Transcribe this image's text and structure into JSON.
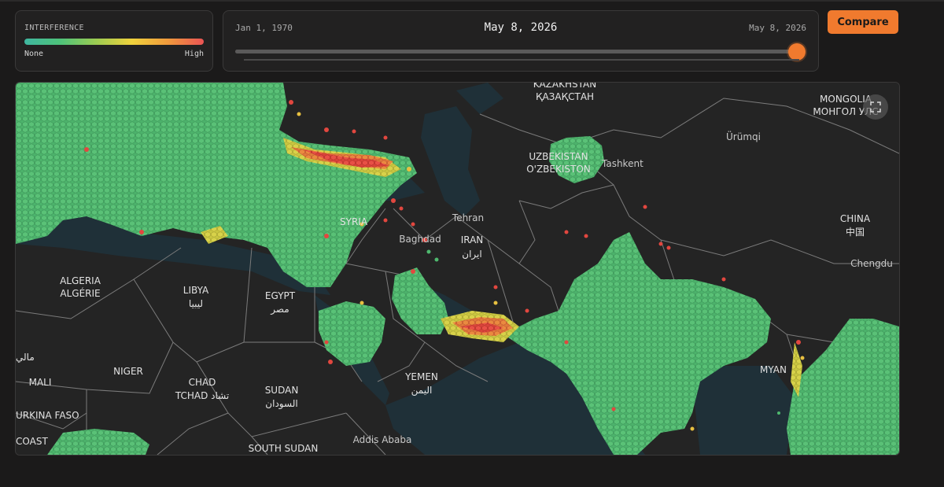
{
  "legend": {
    "title": "INTERFERENCE",
    "min_label": "None",
    "max_label": "High",
    "gradient_colors": [
      "#3fb6a0",
      "#4ec37a",
      "#9ccc52",
      "#f0d23c",
      "#f09a3c",
      "#ea5454"
    ]
  },
  "timeline": {
    "start_label": "Jan 1, 1970",
    "current_label": "May 8, 2026",
    "end_label": "May 8, 2026",
    "progress": 0.995
  },
  "compare_button": {
    "label": "Compare"
  },
  "map": {
    "fullscreen_icon": "expand-icon",
    "colors": {
      "land": "#242424",
      "water": "#1f3038",
      "border": "#7b7b7b",
      "low": "#4eb86e",
      "mid": "#e8c040",
      "high": "#e2473f"
    },
    "country_labels": [
      {
        "id": "kazakhstan",
        "lines": [
          "KAZAKHSTAN",
          "ҚАЗАҚСТАН"
        ]
      },
      {
        "id": "mongolia",
        "lines": [
          "MONGOLIA",
          "МОНГОЛ УЛС"
        ]
      },
      {
        "id": "uzbekistan",
        "lines": [
          "UZBEKISTAN",
          "O'ZBEKISTON"
        ]
      },
      {
        "id": "iran",
        "lines": [
          "IRAN",
          "ایران"
        ]
      },
      {
        "id": "china",
        "lines": [
          "CHINA",
          "中国"
        ]
      },
      {
        "id": "algeria",
        "lines": [
          "ALGERIA",
          "ALGÉRIE"
        ]
      },
      {
        "id": "libya",
        "lines": [
          "LIBYA",
          "ليبيا"
        ]
      },
      {
        "id": "egypt",
        "lines": [
          "EGYPT",
          "مصر"
        ]
      },
      {
        "id": "niger",
        "lines": [
          "NIGER"
        ]
      },
      {
        "id": "chad",
        "lines": [
          "CHAD",
          "TCHAD تشاد"
        ]
      },
      {
        "id": "sudan",
        "lines": [
          "SUDAN",
          "السودان"
        ]
      },
      {
        "id": "yemen",
        "lines": [
          "YEMEN",
          "اليمن"
        ]
      },
      {
        "id": "mali",
        "lines": [
          "MALI"
        ]
      },
      {
        "id": "burkina",
        "lines": [
          "URKINA FASO"
        ]
      },
      {
        "id": "south-sudan",
        "lines": [
          "SOUTH SUDAN"
        ]
      },
      {
        "id": "myanmar",
        "lines": [
          "MYAN"
        ]
      },
      {
        "id": "syria",
        "lines": [
          "SYRIA"
        ]
      },
      {
        "id": "mali-ar",
        "lines": [
          "مالي"
        ]
      },
      {
        "id": "coast",
        "lines": [
          "COAST"
        ]
      }
    ],
    "city_labels": [
      "Tehran",
      "Ürümqi",
      "Chengdu",
      "Addis Ababa",
      "Baghdad",
      "Tashkent"
    ]
  }
}
